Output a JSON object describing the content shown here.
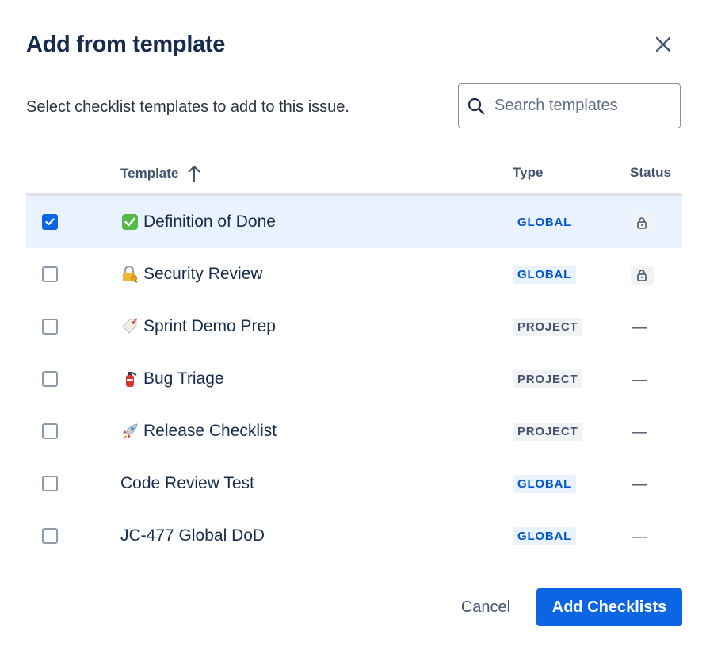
{
  "dialog": {
    "title": "Add from template",
    "subtitle": "Select checklist templates to add to this issue."
  },
  "search": {
    "placeholder": "Search templates",
    "value": ""
  },
  "table": {
    "columns": {
      "template": "Template",
      "type": "Type",
      "status": "Status"
    },
    "sort": {
      "column": "Template",
      "direction": "ascending",
      "icon": "arrow-up-icon"
    },
    "rows": [
      {
        "name": "Definition of Done",
        "emoji": "check-mark-button-icon",
        "type": "GLOBAL",
        "status": "locked",
        "checked": true
      },
      {
        "name": "Security Review",
        "emoji": "locked-with-key-icon",
        "type": "GLOBAL",
        "status": "locked",
        "checked": false
      },
      {
        "name": "Sprint Demo Prep",
        "emoji": "label-tag-icon",
        "type": "PROJECT",
        "status": "—",
        "checked": false
      },
      {
        "name": "Bug Triage",
        "emoji": "fire-extinguisher-icon",
        "type": "PROJECT",
        "status": "—",
        "checked": false
      },
      {
        "name": "Release Checklist",
        "emoji": "rocket-icon",
        "type": "PROJECT",
        "status": "—",
        "checked": false
      },
      {
        "name": "Code Review Test",
        "emoji": "",
        "type": "GLOBAL",
        "status": "—",
        "checked": false
      },
      {
        "name": "JC-477 Global DoD",
        "emoji": "",
        "type": "GLOBAL",
        "status": "—",
        "checked": false
      }
    ]
  },
  "footer": {
    "cancel_label": "Cancel",
    "submit_label": "Add Checklists"
  },
  "colors": {
    "primary": "#0c66e4",
    "selected_row": "#e9f2ff",
    "global_badge_text": "#0055cc",
    "project_badge_bg": "#f1f2f4"
  }
}
